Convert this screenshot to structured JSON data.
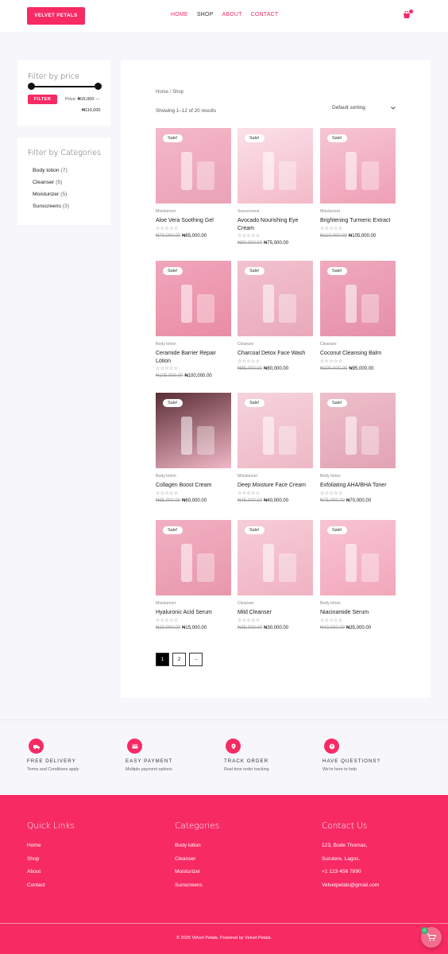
{
  "header": {
    "logo": "VELVET PETALS",
    "nav": [
      "HOME",
      "SHOP",
      "ABOUT",
      "CONTACT"
    ],
    "active_nav": "SHOP"
  },
  "sidebar": {
    "price_filter": {
      "title": "Filter by price",
      "button": "FILTER",
      "price_label": "Price:",
      "min": "₦15,000",
      "dash": "—",
      "max": "₦110,000"
    },
    "categories": {
      "title": "Filter by Categories",
      "items": [
        {
          "name": "Body lotion",
          "count": "(7)"
        },
        {
          "name": "Cleanser",
          "count": "(5)"
        },
        {
          "name": "Moisturizer",
          "count": "(5)"
        },
        {
          "name": "Sunscreens",
          "count": "(3)"
        }
      ]
    }
  },
  "shop": {
    "breadcrumb": "Home / Shop",
    "result_count": "Showing 1–12 of 20 results",
    "sorting": "Default sorting",
    "sale_badge": "Sale!",
    "rating_glyphs": "☆☆☆☆☆",
    "products": [
      {
        "category": "Moisturizer",
        "name": "Aloe Vera Soothing Gel",
        "old_price": "₦70,000.00",
        "price": "₦65,000.00"
      },
      {
        "category": "Sunscreens",
        "name": "Avocado Nourishing Eye Cream",
        "old_price": "₦80,000.00",
        "price": "₦75,000.00"
      },
      {
        "category": "Moisturizer",
        "name": "Brightening Turmeric Extract",
        "old_price": "₦110,000.00",
        "price": "₦105,000.00"
      },
      {
        "category": "Body lotion",
        "name": "Ceramide Barrier Repair Lotion",
        "old_price": "₦105,000.00",
        "price": "₦100,000.00"
      },
      {
        "category": "Cleanser",
        "name": "Charcoal Detox Face Wash",
        "old_price": "₦85,000.00",
        "price": "₦80,000.00"
      },
      {
        "category": "Cleanser",
        "name": "Coconut Cleansing Balm",
        "old_price": "₦100,000.00",
        "price": "₦95,000.00"
      },
      {
        "category": "Body lotion",
        "name": "Collagen Boost Cream",
        "old_price": "₦65,000.00",
        "price": "₦60,000.00"
      },
      {
        "category": "Moisturizer",
        "name": "Deep Moisture Face Cream",
        "old_price": "₦45,000.00",
        "price": "₦40,000.00"
      },
      {
        "category": "Body lotion",
        "name": "Exfoliating AHA/BHA Toner",
        "old_price": "₦75,000.00",
        "price": "₦70,000.00"
      },
      {
        "category": "Moisturizer",
        "name": "Hyaluronic Acid Serum",
        "old_price": "₦20,000.00",
        "price": "₦15,000.00"
      },
      {
        "category": "Cleanser",
        "name": "Mild Cleanser",
        "old_price": "₦35,000.00",
        "price": "₦30,000.00"
      },
      {
        "category": "Body lotion",
        "name": "Niacinamide Serum",
        "old_price": "₦40,000.00",
        "price": "₦35,000.00"
      }
    ],
    "pagination": [
      "1",
      "2",
      "→"
    ]
  },
  "features": [
    {
      "title": "FREE DELIVERY",
      "subtitle": "Terms and Conditions apply",
      "icon": "truck-icon"
    },
    {
      "title": "EASY PAYMENT",
      "subtitle": "Multiple payment options",
      "icon": "credit-card-icon"
    },
    {
      "title": "TRACK ORDER",
      "subtitle": "Real-time order tracking",
      "icon": "location-pin-icon"
    },
    {
      "title": "HAVE QUESTIONS?",
      "subtitle": "We're here to help",
      "icon": "question-icon"
    }
  ],
  "footer": {
    "quick_links": {
      "title": "Quick Links",
      "items": [
        "Home",
        "Shop",
        "About",
        "Contact"
      ]
    },
    "categories": {
      "title": "Categories",
      "items": [
        "Body lotion",
        "Cleanser",
        "Moisturizer",
        "Sunscreens"
      ]
    },
    "contact": {
      "title": "Contact Us",
      "items": [
        "123, Bode Thomas,",
        "Surulere, Lagos.",
        "+1 123 456 7890",
        "Velvetpetals@gmail.com"
      ]
    },
    "copyright": "© 2025 Velvet Petals. Powered by Velvet Petals."
  },
  "floating_cart": {
    "count": "0"
  },
  "colors": {
    "accent": "#f72a64",
    "background": "#f7f7fb"
  }
}
